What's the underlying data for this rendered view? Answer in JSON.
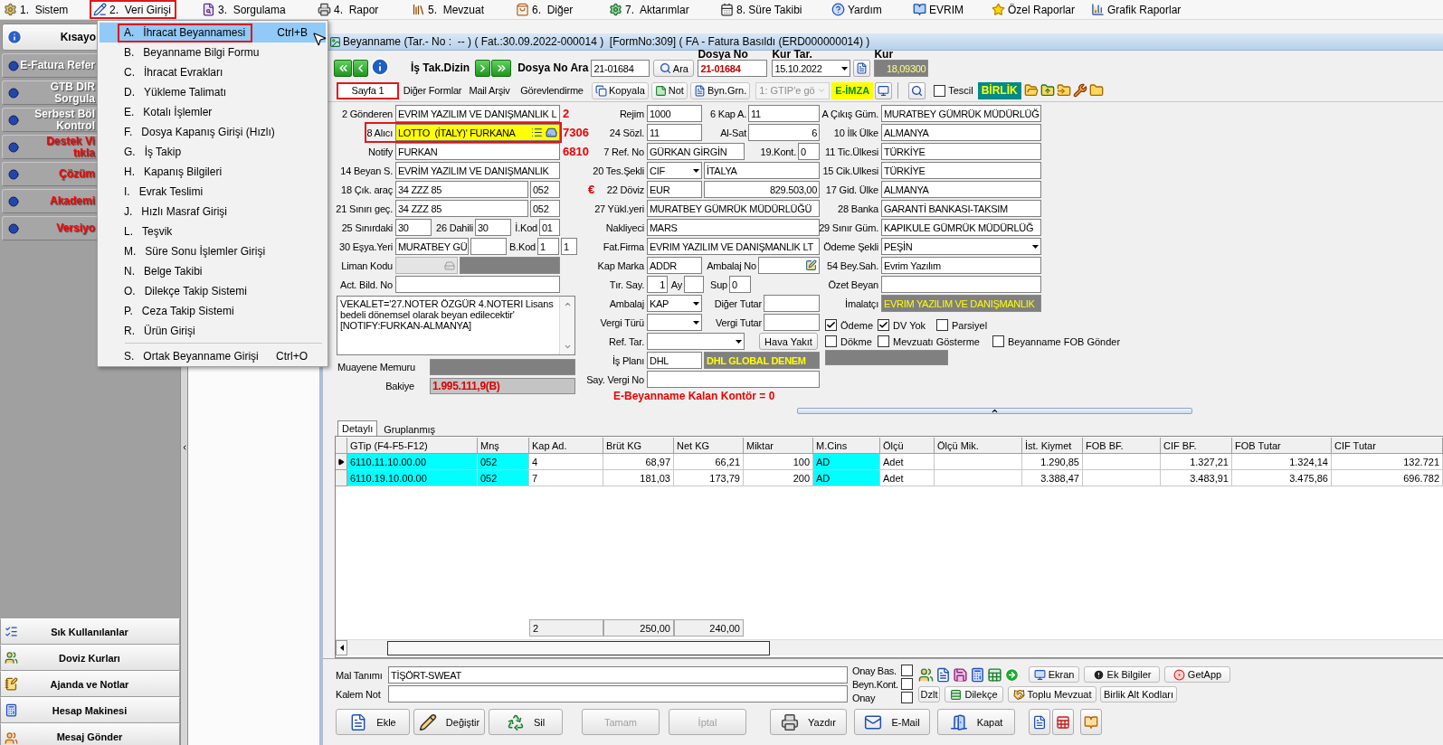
{
  "menu_bar": [
    {
      "label": "1.  Sistem",
      "highlighted": false
    },
    {
      "label": "2.  Veri Girişi",
      "highlighted": true
    },
    {
      "label": "3.  Sorgulama",
      "highlighted": false
    },
    {
      "label": "4.  Rapor",
      "highlighted": false
    },
    {
      "label": "5.  Mevzuat",
      "highlighted": false
    },
    {
      "label": "6.  Diğer",
      "highlighted": false
    },
    {
      "label": "7.  Aktarımlar",
      "highlighted": false
    },
    {
      "label": "8. Süre Takibi",
      "highlighted": false
    },
    {
      "label": "Yardım",
      "highlighted": false
    },
    {
      "label": "EVRIM",
      "highlighted": false
    },
    {
      "label": "Özel Raporlar",
      "highlighted": false
    },
    {
      "label": "Grafik Raporlar",
      "highlighted": false
    }
  ],
  "dropdown": [
    {
      "kind": "item",
      "key": "A.",
      "label": "İhracat Beyannamesi",
      "shortcut": "Ctrl+B",
      "selected": true,
      "highlighted": true
    },
    {
      "kind": "item",
      "key": "B.",
      "label": "Beyanname Bilgi Formu",
      "selected": false,
      "highlighted": false
    },
    {
      "kind": "item",
      "key": "C.",
      "label": "İhracat Evrakları",
      "selected": false,
      "highlighted": false
    },
    {
      "kind": "item",
      "key": "D.",
      "label": "Yükleme Talimatı",
      "selected": false,
      "highlighted": false
    },
    {
      "kind": "item",
      "key": "E.",
      "label": "Kotalı İşlemler",
      "selected": false,
      "highlighted": false
    },
    {
      "kind": "item",
      "key": "F.",
      "label": "Dosya Kapanış Girişi (Hızlı)",
      "selected": false,
      "highlighted": false
    },
    {
      "kind": "item",
      "key": "G.",
      "label": "İş Takip",
      "selected": false,
      "highlighted": false
    },
    {
      "kind": "item",
      "key": "H.",
      "label": "Kapanış Bilgileri",
      "selected": false,
      "highlighted": false
    },
    {
      "kind": "item",
      "key": "I.",
      "label": "Evrak Teslimi",
      "selected": false,
      "highlighted": false
    },
    {
      "kind": "item",
      "key": "J.",
      "label": "Hızlı Masraf Girişi",
      "selected": false,
      "highlighted": false
    },
    {
      "kind": "item",
      "key": "L.",
      "label": "Teşvik",
      "selected": false,
      "highlighted": false
    },
    {
      "kind": "item",
      "key": "M.",
      "label": "Süre Sonu İşlemler Girişi",
      "selected": false,
      "highlighted": false
    },
    {
      "kind": "item",
      "key": "N.",
      "label": "Belge Takibi",
      "selected": false,
      "highlighted": false
    },
    {
      "kind": "item",
      "key": "O.",
      "label": "Dilekçe Takip Sistemi",
      "selected": false,
      "highlighted": false
    },
    {
      "kind": "item",
      "key": "P.",
      "label": "Ceza Takip Sistemi",
      "selected": false,
      "highlighted": false
    },
    {
      "kind": "item",
      "key": "R.",
      "label": "Ürün Girişi",
      "selected": false,
      "highlighted": false
    },
    {
      "kind": "separator"
    },
    {
      "kind": "item",
      "key": "S.",
      "label": "Ortak Beyanname Girişi",
      "shortcut": "Ctrl+O",
      "selected": false,
      "highlighted": false
    }
  ],
  "sidebar": {
    "header": "Kısayo",
    "shortcuts": [
      {
        "lines": [
          "E-Fatura Refer"
        ],
        "color": "#ffffff"
      },
      {
        "lines": [
          "GTB DIR",
          "Sorgula"
        ],
        "color": "#ffffff"
      },
      {
        "lines": [
          "Serbest Böl",
          "Kontrol"
        ],
        "color": "#ffffff"
      },
      {
        "lines": [
          "Destek Vi",
          "tıkla"
        ],
        "color": "#ff0000"
      },
      {
        "lines": [
          "Çözüm"
        ],
        "color": "#ff0000"
      },
      {
        "lines": [
          "Akademi"
        ],
        "color": "#ff0000"
      },
      {
        "lines": [
          "Versiyo"
        ],
        "color": "#ff0000"
      }
    ],
    "bottom_items": [
      "Sık Kullanılanlar",
      "Doviz Kurları",
      "Ajanda ve Notlar",
      "Hesap Makinesi",
      "Mesaj Gönder"
    ]
  },
  "window": {
    "title": "Beyanname (Tar.- No :  -- ) ( Fat.:30.09.2022-000014 )  [FormNo:309] ( FA - Fatura Basıldı (ERD000000014) )"
  },
  "nav": {
    "dizin_label": "İş Tak.Dizin",
    "search_label": "Dosya No Ara",
    "search_value": "21-01684",
    "search_button": "Ara",
    "file_no_label": "Dosya No",
    "file_no": "21-01684",
    "rate_date_label": "Kur Tar.",
    "rate_date": "15.10.2022",
    "rate_label": "Kur",
    "rate": "18,09300"
  },
  "tabs": [
    {
      "label": "Sayfa 1",
      "selected": true,
      "highlighted": true
    },
    {
      "label": "Diğer Formlar",
      "selected": false,
      "highlighted": false
    },
    {
      "label": "Mail Arşiv",
      "selected": false,
      "highlighted": false
    },
    {
      "label": "Görevlendirme",
      "selected": false,
      "highlighted": false
    }
  ],
  "toolbar": {
    "copy": "Kopyala",
    "note": "Not",
    "byn": "Byn.Grn.",
    "gtip_select": {
      "value": "1: GTIP'e gö",
      "disabled": true
    },
    "e_sign": "E-İMZA",
    "tescil": {
      "label": "Tescil",
      "checked": false
    },
    "birlik": "BİRLİK"
  },
  "form": {
    "left": [
      {
        "label": "2 Gönderen",
        "highlighted": false,
        "cells": [
          {
            "kind": "input",
            "value": "EVRIM YAZILIM VE DANIŞMANLIK L"
          },
          {
            "kind": "note",
            "text": "2"
          }
        ]
      },
      {
        "label": "8 Alıcı",
        "highlighted": true,
        "cells": [
          {
            "kind": "lookup",
            "value": "LOTTO  (İTALY)' FURKANA"
          },
          {
            "kind": "note",
            "text": "7306"
          }
        ]
      },
      {
        "label": "Notify",
        "highlighted": false,
        "cells": [
          {
            "kind": "input",
            "value": "FURKAN"
          },
          {
            "kind": "note",
            "text": "6810"
          }
        ]
      },
      {
        "label": "14 Beyan S.",
        "highlighted": false,
        "cells": [
          {
            "kind": "input",
            "value": "EVRİM YAZILIM VE DANIŞMANLIK"
          }
        ]
      },
      {
        "label": "18 Çık. araç",
        "highlighted": false,
        "cells": [
          {
            "kind": "input",
            "value": "34 ZZZ 85"
          },
          {
            "kind": "input",
            "value": "052"
          }
        ]
      },
      {
        "label": "21 Sınırı geç.",
        "highlighted": false,
        "cells": [
          {
            "kind": "input",
            "value": "34 ZZZ 85"
          },
          {
            "kind": "input",
            "value": "052"
          }
        ]
      },
      {
        "label": "25 Sınırdaki",
        "highlighted": false,
        "cells": [
          {
            "kind": "input",
            "value": "30"
          },
          {
            "kind": "label",
            "text": "26 Dahili"
          },
          {
            "kind": "input",
            "value": "30"
          },
          {
            "kind": "label",
            "text": "İ.Kod"
          },
          {
            "kind": "input",
            "value": "01"
          }
        ]
      },
      {
        "label": "30 Eşya.Yeri",
        "highlighted": false,
        "cells": [
          {
            "kind": "input",
            "value": "MURATBEY GÜ"
          },
          {
            "kind": "input"
          },
          {
            "kind": "label",
            "text": "B.Kod"
          },
          {
            "kind": "input",
            "value": "1"
          },
          {
            "kind": "input",
            "value": "1"
          }
        ]
      },
      {
        "label": "Liman Kodu",
        "highlighted": false,
        "cells": [
          {
            "kind": "locked"
          },
          {
            "kind": "bar"
          }
        ]
      },
      {
        "label": "Act. Bild. No",
        "highlighted": false,
        "cells": [
          {
            "kind": "input"
          }
        ]
      }
    ],
    "memo": "VEKALET='27.NOTER ÖZGÜR 4.NOTERI Lisans bedeli dönemsel olarak beyan edilecektir' [NOTIFY:FURKAN-ALMANYA]",
    "inspector_label": "Muayene Memuru",
    "balance_label": "Bakiye",
    "balance": "1.995.111,9(B)",
    "middle": [
      {
        "label": "Rejim",
        "cells": [
          {
            "kind": "input",
            "value": "1000"
          },
          {
            "kind": "label",
            "text": "6 Kap A."
          },
          {
            "kind": "input",
            "value": "11"
          }
        ]
      },
      {
        "label": "24 Sözl.",
        "cells": [
          {
            "kind": "input",
            "value": "11"
          },
          {
            "kind": "label",
            "text": "Al-Sat"
          },
          {
            "kind": "number",
            "value": "6"
          }
        ]
      },
      {
        "label": "7 Ref. No",
        "cells": [
          {
            "kind": "input",
            "value": "GÜRKAN GİRGİN"
          },
          {
            "kind": "label",
            "text": "19.Kont."
          },
          {
            "kind": "input",
            "value": "0"
          }
        ]
      },
      {
        "label": "20 Tes.Şekli",
        "cells": [
          {
            "kind": "select",
            "value": "CIF"
          },
          {
            "kind": "input",
            "value": "İTALYA"
          }
        ]
      },
      {
        "label": "22 Döviz",
        "mark": "€",
        "cells": [
          {
            "kind": "input",
            "value": "EUR"
          },
          {
            "kind": "number",
            "value": "829.503,00"
          }
        ]
      },
      {
        "label": "27 Yükl.yeri",
        "cells": [
          {
            "kind": "input",
            "value": "MURATBEY GÜMRÜK MÜDÜRLÜĞÜ"
          }
        ]
      },
      {
        "label": "Nakliyeci",
        "cells": [
          {
            "kind": "input",
            "value": "MARS"
          }
        ]
      },
      {
        "label": "Fat.Firma",
        "cells": [
          {
            "kind": "input",
            "value": "EVRIM YAZILIM VE DANIŞMANLIK LT"
          }
        ]
      },
      {
        "label": "Kap Marka",
        "cells": [
          {
            "kind": "input",
            "value": "ADDR"
          },
          {
            "kind": "label",
            "text": "Ambalaj No"
          },
          {
            "kind": "edit"
          }
        ]
      },
      {
        "label": "Tır. Say.",
        "cells": [
          {
            "kind": "number",
            "value": "1"
          },
          {
            "kind": "label",
            "text": "Ay"
          },
          {
            "kind": "input"
          },
          {
            "kind": "label",
            "text": "Sup"
          },
          {
            "kind": "input",
            "value": "0"
          }
        ]
      },
      {
        "label": "Ambalaj",
        "cells": [
          {
            "kind": "select",
            "value": "KAP"
          },
          {
            "kind": "label",
            "text": "Diğer Tutar"
          },
          {
            "kind": "input"
          }
        ]
      },
      {
        "label": "Vergi Türü",
        "cells": [
          {
            "kind": "select"
          },
          {
            "kind": "label",
            "text": "Vergi Tutar"
          },
          {
            "kind": "input"
          }
        ]
      },
      {
        "label": "Ref. Tar.",
        "cells": [
          {
            "kind": "select"
          },
          {
            "kind": "button",
            "text": "Hava Yakıt"
          }
        ]
      },
      {
        "label": "İş Planı",
        "cells": [
          {
            "kind": "input",
            "value": "DHL"
          },
          {
            "kind": "grey-bold",
            "value": "DHL GLOBAL DENEM"
          }
        ]
      },
      {
        "label": "Say. Vergi No",
        "cells": [
          {
            "kind": "input"
          }
        ]
      }
    ],
    "kontor": "E-Beyanname Kalan Kontör = 0",
    "right": [
      {
        "label": "A Çıkış Güm.",
        "cells": [
          {
            "kind": "input",
            "value": "MURATBEY GÜMRÜK MÜDÜRLÜĞ"
          }
        ]
      },
      {
        "label": "10 İlk Ülke",
        "cells": [
          {
            "kind": "input",
            "value": "ALMANYA"
          }
        ]
      },
      {
        "label": "11 Tic.Ülkesi",
        "cells": [
          {
            "kind": "input",
            "value": "TÜRKİYE"
          }
        ]
      },
      {
        "label": "15 Cik.Ulkesi",
        "cells": [
          {
            "kind": "input",
            "value": "TÜRKİYE"
          }
        ]
      },
      {
        "label": "17 Gid. Ülke",
        "cells": [
          {
            "kind": "input",
            "value": "ALMANYA"
          }
        ]
      },
      {
        "label": "28 Banka",
        "cells": [
          {
            "kind": "input",
            "value": "GARANTİ BANKASI-TAKSIM"
          }
        ]
      },
      {
        "label": "29 Sınır Güm.",
        "cells": [
          {
            "kind": "input",
            "value": "KAPIKULE GÜMRÜK MÜDÜRLÜĞ"
          }
        ]
      },
      {
        "label": "Ödeme Şekli",
        "cells": [
          {
            "kind": "select",
            "value": "PEŞİN"
          }
        ]
      },
      {
        "label": "54 Bey.Sah.",
        "cells": [
          {
            "kind": "input",
            "value": "Evrim Yazılım"
          }
        ]
      },
      {
        "label": "Özet Beyan",
        "cells": [
          {
            "kind": "input"
          }
        ]
      },
      {
        "label": "İmalatçı",
        "cells": [
          {
            "kind": "grey",
            "value": "EVRIM YAZILIM VE DANIŞMANLIK"
          }
        ]
      }
    ],
    "checks": [
      [
        {
          "label": "Ödeme",
          "checked": true
        },
        {
          "label": "DV Yok",
          "checked": true
        },
        {
          "label": "Parsiyel",
          "checked": false
        }
      ],
      [
        {
          "label": "Dökme",
          "checked": false
        },
        {
          "label": "Mevzuatı Gösterme",
          "checked": false
        },
        {
          "label": "Beyanname FOB Gönder",
          "checked": false
        }
      ]
    ]
  },
  "grid_tabs": [
    {
      "label": "Detaylı",
      "selected": true
    },
    {
      "label": "Gruplanmış",
      "selected": false
    }
  ],
  "grid": {
    "columns": [
      {
        "label": "GTip (F4-F5-F12)",
        "kind": "text",
        "color": "#00ffff"
      },
      {
        "label": "Mnş",
        "kind": "text",
        "color": "#00ffff"
      },
      {
        "label": "Kap Ad.",
        "kind": "text",
        "color": "#ffffff",
        "total": "2"
      },
      {
        "label": "Brüt KG",
        "kind": "number",
        "color": "#ffffff",
        "total": "250,00"
      },
      {
        "label": "Net KG",
        "kind": "number",
        "color": "#ffffff",
        "total": "240,00"
      },
      {
        "label": "Miktar",
        "kind": "number",
        "color": "#ffffff"
      },
      {
        "label": "M.Cins",
        "kind": "text",
        "color": "#00ffff"
      },
      {
        "label": "Ölçü",
        "kind": "text",
        "color": "#ffffff"
      },
      {
        "label": "Ölçü Mik.",
        "kind": "number",
        "color": "#ffffff"
      },
      {
        "label": "İst. Kiymet",
        "kind": "number",
        "color": "#ffffff"
      },
      {
        "label": "FOB BF.",
        "kind": "number",
        "color": "#ffffff"
      },
      {
        "label": "CIF BF.",
        "kind": "number",
        "color": "#ffffff"
      },
      {
        "label": "FOB Tutar",
        "kind": "number",
        "color": "#ffffff"
      },
      {
        "label": "CIF Tutar",
        "kind": "number",
        "color": "#ffffff"
      }
    ],
    "rows": [
      {
        "selected": true,
        "cells": [
          "6110.11.10.00.00",
          "052",
          "4",
          "68,97",
          "66,21",
          "100",
          "AD",
          "Adet",
          null,
          "1.290,85",
          null,
          "1.327,21",
          "1.324,14",
          "132.721"
        ]
      },
      {
        "selected": false,
        "cells": [
          "6110.19.10.00.00",
          "052",
          "7",
          "181,03",
          "173,79",
          "200",
          "AD",
          "Adet",
          null,
          "3.388,47",
          null,
          "3.483,91",
          "3.475,86",
          "696.782"
        ]
      }
    ]
  },
  "bottom": {
    "fields": [
      {
        "label": "Mal Tanımı",
        "value": "TİŞÖRT-SWEAT"
      },
      {
        "label": "Kalem Not"
      }
    ],
    "approvals": [
      {
        "label": "Onay Bas.",
        "checked": false
      },
      {
        "label": "Beyn.Kont.",
        "checked": false
      },
      {
        "label": "Onay",
        "checked": false
      }
    ],
    "tool_buttons": [
      "Ekran",
      "Ek Bilgiler",
      "GetApp"
    ],
    "link_buttons": [
      "Dzlt",
      "Dilekçe",
      "Toplu Mevzuat",
      "Birlik Alt Kodları"
    ],
    "actions": [
      {
        "label": "Ekle",
        "disabled": false
      },
      {
        "label": "Değiştir",
        "disabled": false
      },
      {
        "label": "Sil",
        "disabled": false
      },
      {
        "label": "Tamam",
        "disabled": true
      },
      {
        "label": "İptal",
        "disabled": true
      },
      {
        "label": "Yazdır",
        "disabled": false
      },
      {
        "label": "E-Mail",
        "disabled": false
      },
      {
        "label": "Kapat",
        "disabled": false
      }
    ]
  }
}
